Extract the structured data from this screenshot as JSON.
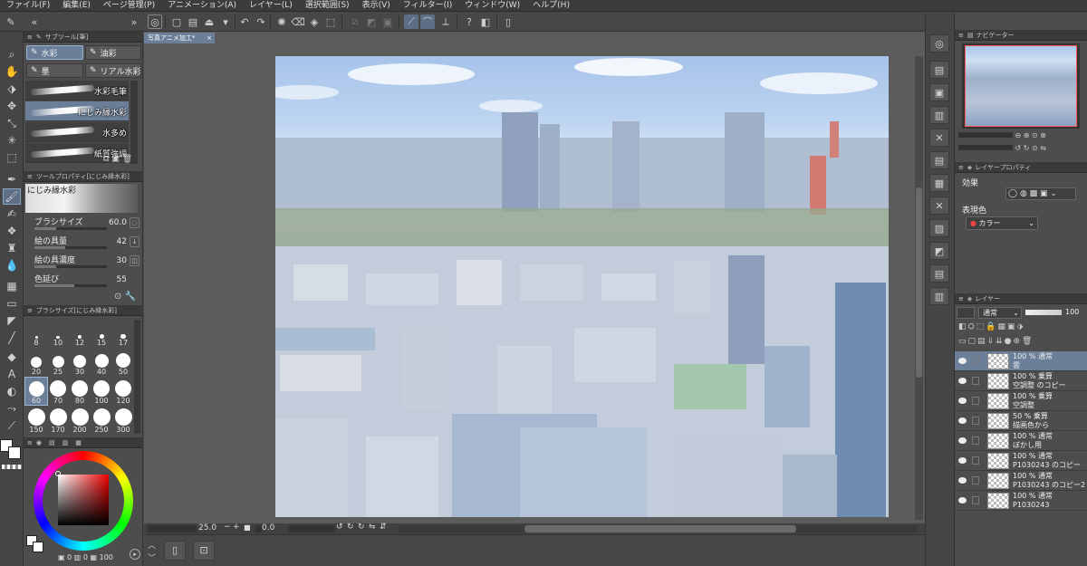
{
  "menu": [
    "ファイル(F)",
    "編集(E)",
    "ページ管理(P)",
    "アニメーション(A)",
    "レイヤー(L)",
    "選択範囲(S)",
    "表示(V)",
    "フィルター(I)",
    "ウィンドウ(W)",
    "ヘルプ(H)"
  ],
  "document_tab": "写真アニメ加工*",
  "subtool_panel": {
    "title": "サブツール[筆]",
    "groups": [
      "水彩",
      "油彩",
      "墨",
      "リアル水彩"
    ],
    "brushes": [
      "水彩毛筆",
      "にじみ縁水彩",
      "水多め",
      "紙質強調"
    ]
  },
  "tool_property": {
    "title": "ツールプロパティ[にじみ縁水彩]",
    "brush_name": "にじみ縁水彩",
    "rows": [
      {
        "label": "ブラシサイズ",
        "value": "60.0",
        "fill": 0.3
      },
      {
        "label": "絵の具量",
        "value": "42",
        "fill": 0.42
      },
      {
        "label": "絵の具濃度",
        "value": "30",
        "fill": 0.3
      },
      {
        "label": "色延び",
        "value": "55",
        "fill": 0.55
      }
    ]
  },
  "brush_size_panel": {
    "title": "ブラシサイズ[にじみ縁水彩]",
    "sizes": [
      "8",
      "10",
      "12",
      "15",
      "17",
      "20",
      "25",
      "30",
      "40",
      "50",
      "60",
      "70",
      "80",
      "100",
      "120",
      "150",
      "170",
      "200",
      "250",
      "300"
    ],
    "selected": "60"
  },
  "color_footer": [
    "0",
    "0",
    "100"
  ],
  "canvas_footer": {
    "zoom": "25.0",
    "angle": "0.0"
  },
  "navigator": {
    "title": "ナビゲーター"
  },
  "layer_property": {
    "title": "レイヤープロパティ",
    "effect_label": "効果",
    "expression_label": "表現色",
    "expression_value": "カラー"
  },
  "layers_panel": {
    "title": "レイヤー",
    "blend_mode": "通常",
    "opacity": "100",
    "layers": [
      {
        "mode": "100 % 通常",
        "name": "雲"
      },
      {
        "mode": "100 % 乗算",
        "name": "空調整 のコピー"
      },
      {
        "mode": "100 % 乗算",
        "name": "空調整"
      },
      {
        "mode": "50 % 乗算",
        "name": "描画色から"
      },
      {
        "mode": "100 % 通常",
        "name": "ぼかし用"
      },
      {
        "mode": "100 % 通常",
        "name": "P1030243 のコピー"
      },
      {
        "mode": "100 % 通常",
        "name": "P1030243 のコピー2"
      },
      {
        "mode": "100 % 通常",
        "name": "P1030243"
      }
    ]
  },
  "colors": {
    "accent": "#6b7f99",
    "panel": "#4d4d4d",
    "menubar": "#3c3c3c"
  }
}
